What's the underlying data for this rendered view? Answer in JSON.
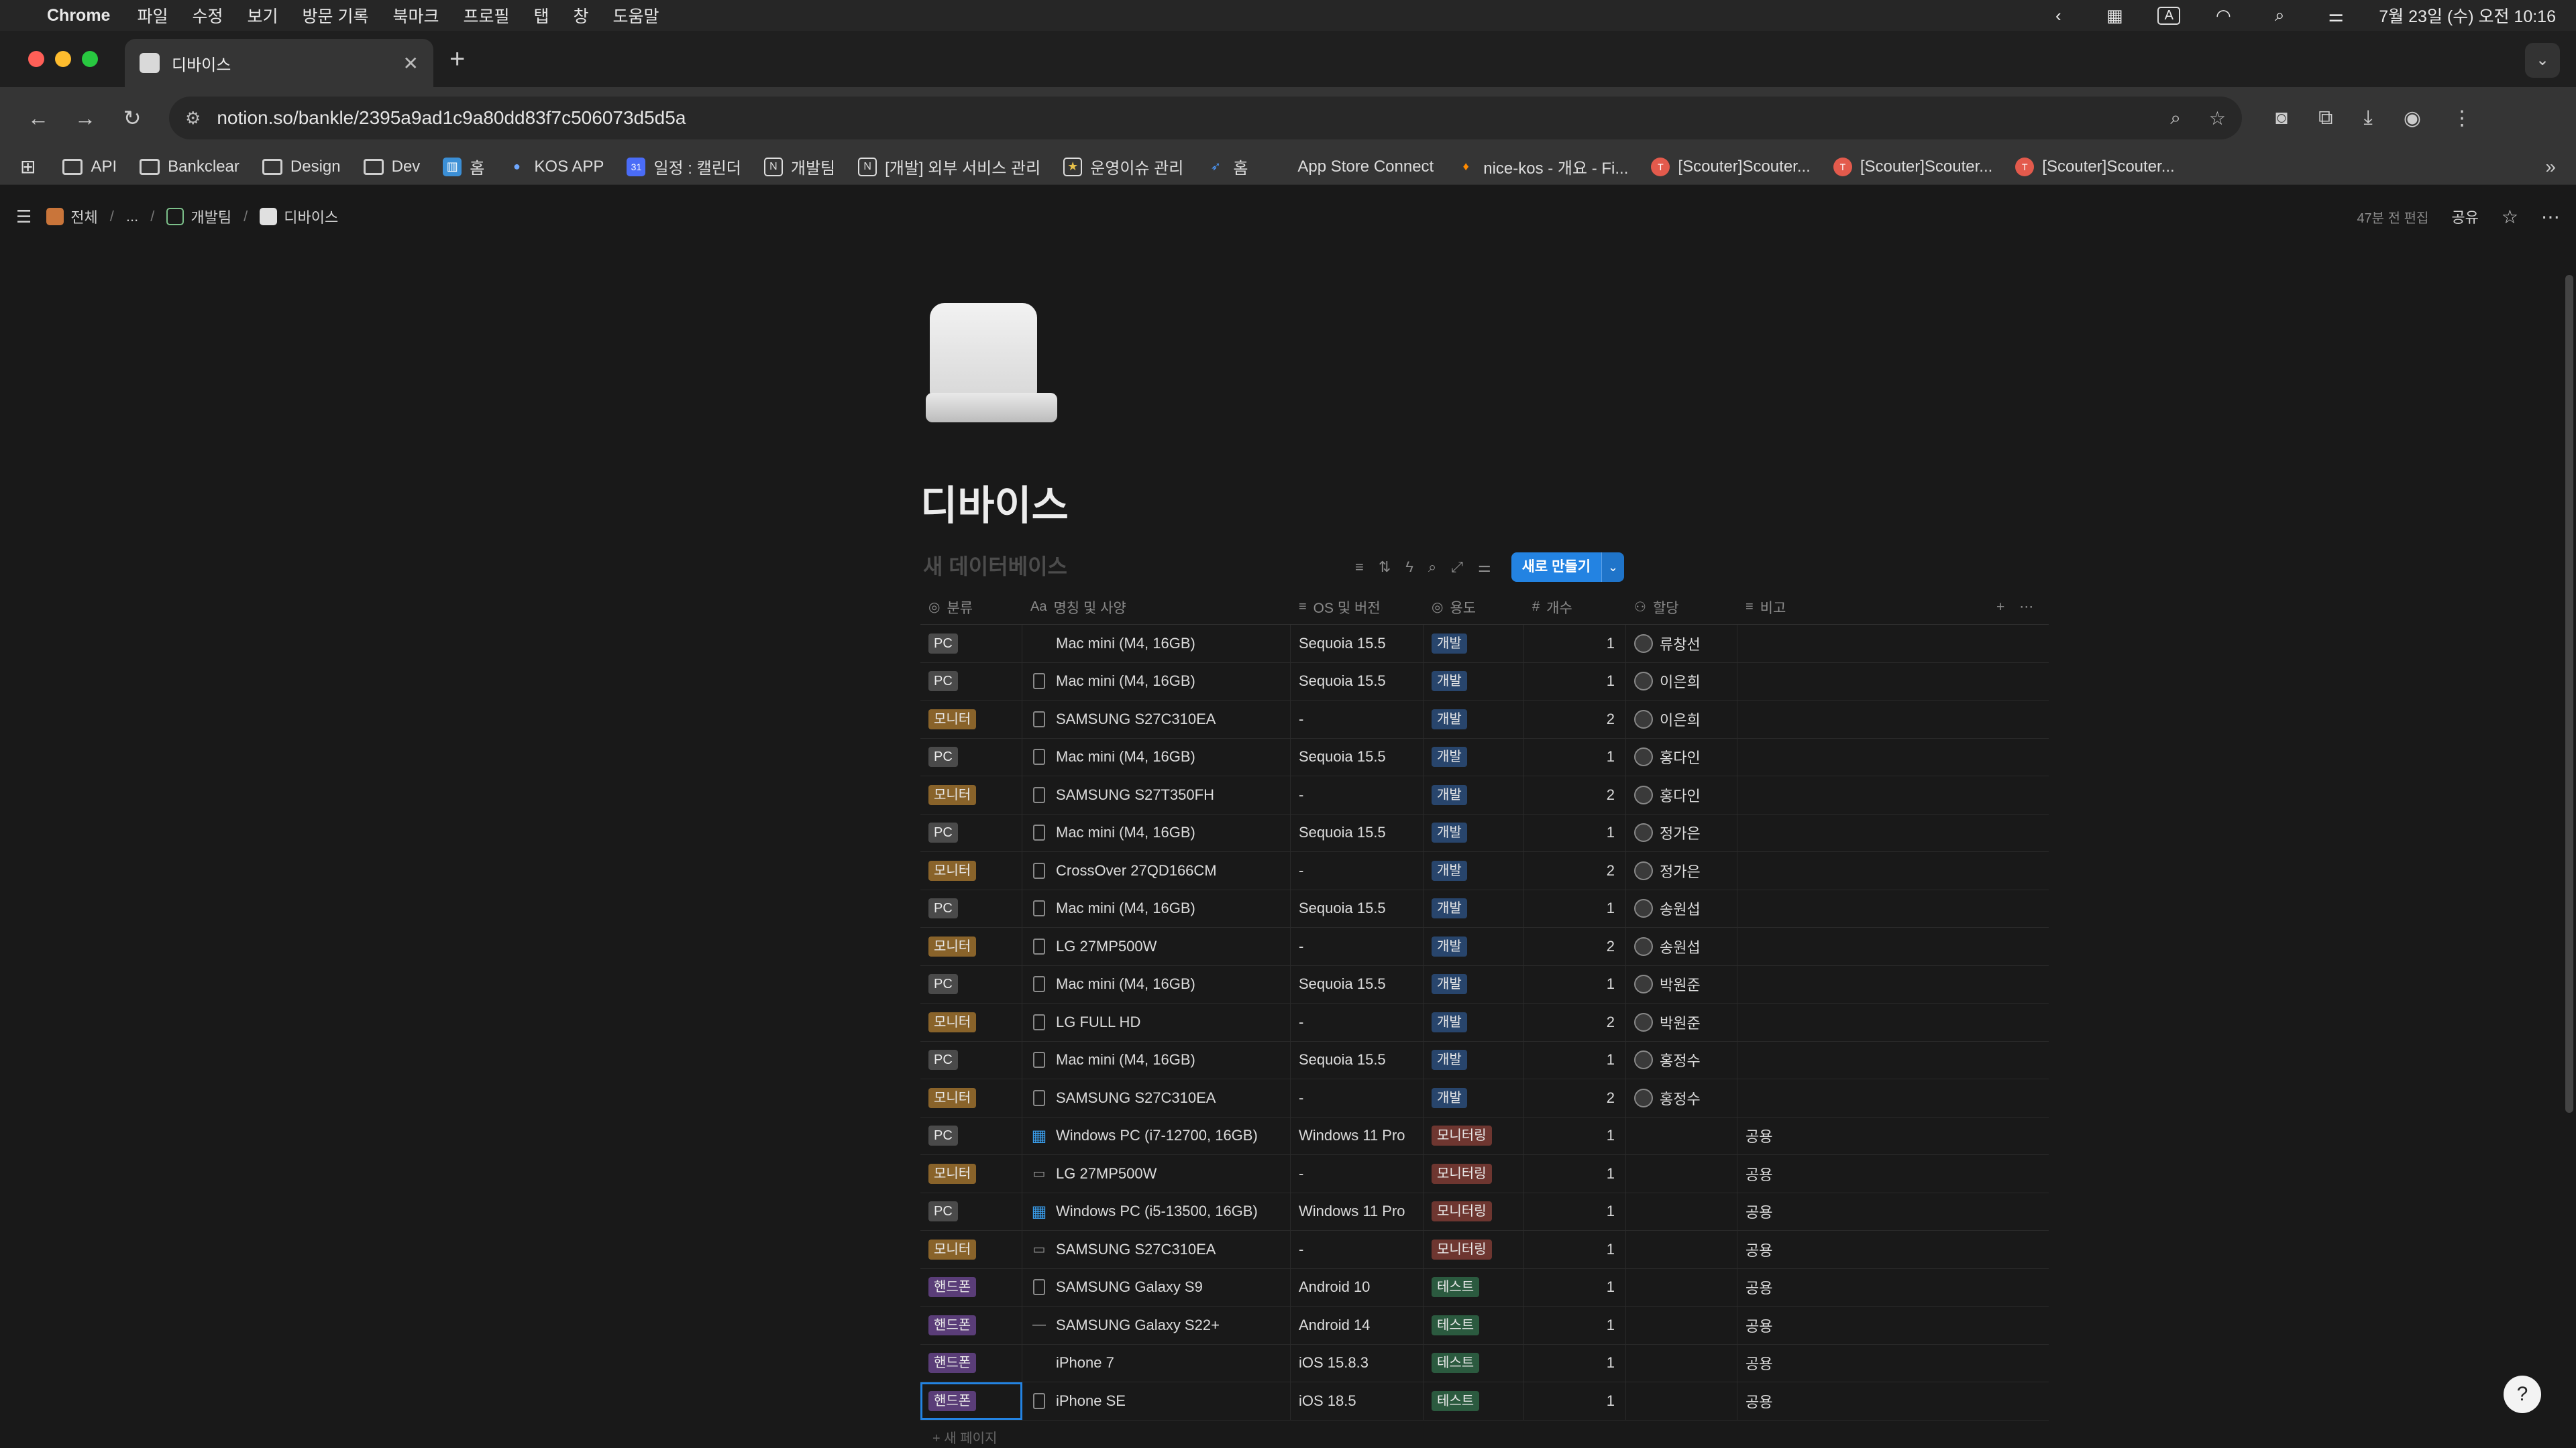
{
  "menubar": {
    "app": "Chrome",
    "items": [
      "파일",
      "수정",
      "보기",
      "방문 기록",
      "북마크",
      "프로필",
      "탭",
      "창",
      "도움말"
    ],
    "clock": "7월 23일 (수) 오전 10:16",
    "input_indicator": "A"
  },
  "browser": {
    "tab_title": "디바이스",
    "url": "notion.so/bankle/2395a9ad1c9a80dd83f7c506073d5d5a"
  },
  "bookmarks": [
    {
      "label": "API",
      "icon": "folder-icon"
    },
    {
      "label": "Bankclear",
      "icon": "folder-icon"
    },
    {
      "label": "Design",
      "icon": "folder-icon"
    },
    {
      "label": "Dev",
      "icon": "folder-icon"
    },
    {
      "label": "홈",
      "icon": "board-icon"
    },
    {
      "label": "KOS APP",
      "icon": "app-icon"
    },
    {
      "label": "일정 : 캘린더",
      "icon": "calendar-icon"
    },
    {
      "label": "개발팀",
      "icon": "notion-icon"
    },
    {
      "label": "[개발] 외부 서비스 관리",
      "icon": "notion-icon"
    },
    {
      "label": "운영이슈 관리",
      "icon": "page-icon"
    },
    {
      "label": "홈",
      "icon": "jira-icon"
    },
    {
      "label": "App Store Connect",
      "icon": "apple-icon"
    },
    {
      "label": "nice-kos - 개요 - Fi...",
      "icon": "firebase-icon"
    },
    {
      "label": "[Scouter]Scouter...",
      "icon": "scouter-icon"
    },
    {
      "label": "[Scouter]Scouter...",
      "icon": "scouter-icon"
    },
    {
      "label": "[Scouter]Scouter...",
      "icon": "scouter-icon"
    }
  ],
  "notion": {
    "breadcrumb": [
      "전체",
      "...",
      "개발팀",
      "디바이스"
    ],
    "edited": "47분 전 편집",
    "share": "공유",
    "page_title": "디바이스",
    "db_name": "새 데이터베이스",
    "new_button": "새로 만들기",
    "new_page": "+ 새 페이지",
    "columns": [
      "분류",
      "명칭 및 사양",
      "OS 및 버전",
      "용도",
      "개수",
      "할당",
      "비고"
    ]
  },
  "colors": {
    "tag_pc": "#4a4a4a",
    "tag_monitor": "#89632a",
    "tag_phone": "#5a3d78",
    "tag_dev": "#28456c",
    "tag_monitoring": "#6e3630",
    "tag_test": "#2b5a3f",
    "accent": "#2383e2"
  },
  "rows": [
    {
      "cat": "PC",
      "cat_type": "pc",
      "icon": "apple-icon",
      "name": "Mac mini (M4, 16GB)",
      "os": "Sequoia 15.5",
      "use": "개발",
      "use_type": "dev",
      "count": "1",
      "assignee": "류창선",
      "note": ""
    },
    {
      "cat": "PC",
      "cat_type": "pc",
      "icon": "page-icon",
      "name": "Mac mini (M4, 16GB)",
      "os": "Sequoia 15.5",
      "use": "개발",
      "use_type": "dev",
      "count": "1",
      "assignee": "이은희",
      "note": ""
    },
    {
      "cat": "모니터",
      "cat_type": "monitor",
      "icon": "page-icon",
      "name": "SAMSUNG S27C310EA",
      "os": "-",
      "use": "개발",
      "use_type": "dev",
      "count": "2",
      "assignee": "이은희",
      "note": ""
    },
    {
      "cat": "PC",
      "cat_type": "pc",
      "icon": "page-icon",
      "name": "Mac mini (M4, 16GB)",
      "os": "Sequoia 15.5",
      "use": "개발",
      "use_type": "dev",
      "count": "1",
      "assignee": "홍다인",
      "note": ""
    },
    {
      "cat": "모니터",
      "cat_type": "monitor",
      "icon": "page-icon",
      "name": "SAMSUNG S27T350FH",
      "os": "-",
      "use": "개발",
      "use_type": "dev",
      "count": "2",
      "assignee": "홍다인",
      "note": ""
    },
    {
      "cat": "PC",
      "cat_type": "pc",
      "icon": "page-icon",
      "name": "Mac mini (M4, 16GB)",
      "os": "Sequoia 15.5",
      "use": "개발",
      "use_type": "dev",
      "count": "1",
      "assignee": "정가은",
      "note": ""
    },
    {
      "cat": "모니터",
      "cat_type": "monitor",
      "icon": "page-icon",
      "name": "CrossOver 27QD166CM",
      "os": "-",
      "use": "개발",
      "use_type": "dev",
      "count": "2",
      "assignee": "정가은",
      "note": ""
    },
    {
      "cat": "PC",
      "cat_type": "pc",
      "icon": "page-icon",
      "name": "Mac mini (M4, 16GB)",
      "os": "Sequoia 15.5",
      "use": "개발",
      "use_type": "dev",
      "count": "1",
      "assignee": "송원섭",
      "note": ""
    },
    {
      "cat": "모니터",
      "cat_type": "monitor",
      "icon": "page-icon",
      "name": "LG 27MP500W",
      "os": "-",
      "use": "개발",
      "use_type": "dev",
      "count": "2",
      "assignee": "송원섭",
      "note": ""
    },
    {
      "cat": "PC",
      "cat_type": "pc",
      "icon": "page-icon",
      "name": "Mac mini (M4, 16GB)",
      "os": "Sequoia 15.5",
      "use": "개발",
      "use_type": "dev",
      "count": "1",
      "assignee": "박원준",
      "note": ""
    },
    {
      "cat": "모니터",
      "cat_type": "monitor",
      "icon": "page-icon",
      "name": "LG FULL HD",
      "os": "-",
      "use": "개발",
      "use_type": "dev",
      "count": "2",
      "assignee": "박원준",
      "note": ""
    },
    {
      "cat": "PC",
      "cat_type": "pc",
      "icon": "page-icon",
      "name": "Mac mini (M4, 16GB)",
      "os": "Sequoia 15.5",
      "use": "개발",
      "use_type": "dev",
      "count": "1",
      "assignee": "홍정수",
      "note": ""
    },
    {
      "cat": "모니터",
      "cat_type": "monitor",
      "icon": "page-icon",
      "name": "SAMSUNG S27C310EA",
      "os": "-",
      "use": "개발",
      "use_type": "dev",
      "count": "2",
      "assignee": "홍정수",
      "note": ""
    },
    {
      "cat": "PC",
      "cat_type": "pc",
      "icon": "windows-icon",
      "name": "Windows PC (i7-12700, 16GB)",
      "os": "Windows 11 Pro",
      "use": "모니터링",
      "use_type": "monitoring",
      "count": "1",
      "assignee": "",
      "note": "공용"
    },
    {
      "cat": "모니터",
      "cat_type": "monitor",
      "icon": "monitor-icon",
      "name": "LG 27MP500W",
      "os": "-",
      "use": "모니터링",
      "use_type": "monitoring",
      "count": "1",
      "assignee": "",
      "note": "공용"
    },
    {
      "cat": "PC",
      "cat_type": "pc",
      "icon": "windows-icon",
      "name": "Windows PC (i5-13500, 16GB)",
      "os": "Windows 11 Pro",
      "use": "모니터링",
      "use_type": "monitoring",
      "count": "1",
      "assignee": "",
      "note": "공용"
    },
    {
      "cat": "모니터",
      "cat_type": "monitor",
      "icon": "monitor-icon",
      "name": "SAMSUNG S27C310EA",
      "os": "-",
      "use": "모니터링",
      "use_type": "monitoring",
      "count": "1",
      "assignee": "",
      "note": "공용"
    },
    {
      "cat": "핸드폰",
      "cat_type": "phone",
      "icon": "page-icon",
      "name": "SAMSUNG Galaxy S9",
      "os": "Android 10",
      "use": "테스트",
      "use_type": "test",
      "count": "1",
      "assignee": "",
      "note": "공용"
    },
    {
      "cat": "핸드폰",
      "cat_type": "phone",
      "icon": "dash-icon",
      "name": "SAMSUNG Galaxy S22+",
      "os": "Android 14",
      "use": "테스트",
      "use_type": "test",
      "count": "1",
      "assignee": "",
      "note": "공용"
    },
    {
      "cat": "핸드폰",
      "cat_type": "phone",
      "icon": "apple-icon",
      "name": "iPhone 7",
      "os": "iOS 15.8.3",
      "use": "테스트",
      "use_type": "test",
      "count": "1",
      "assignee": "",
      "note": "공용"
    },
    {
      "cat": "핸드폰",
      "cat_type": "phone",
      "icon": "page-icon",
      "name": "iPhone SE",
      "os": "iOS 18.5",
      "use": "테스트",
      "use_type": "test",
      "count": "1",
      "assignee": "",
      "note": "공용"
    }
  ]
}
